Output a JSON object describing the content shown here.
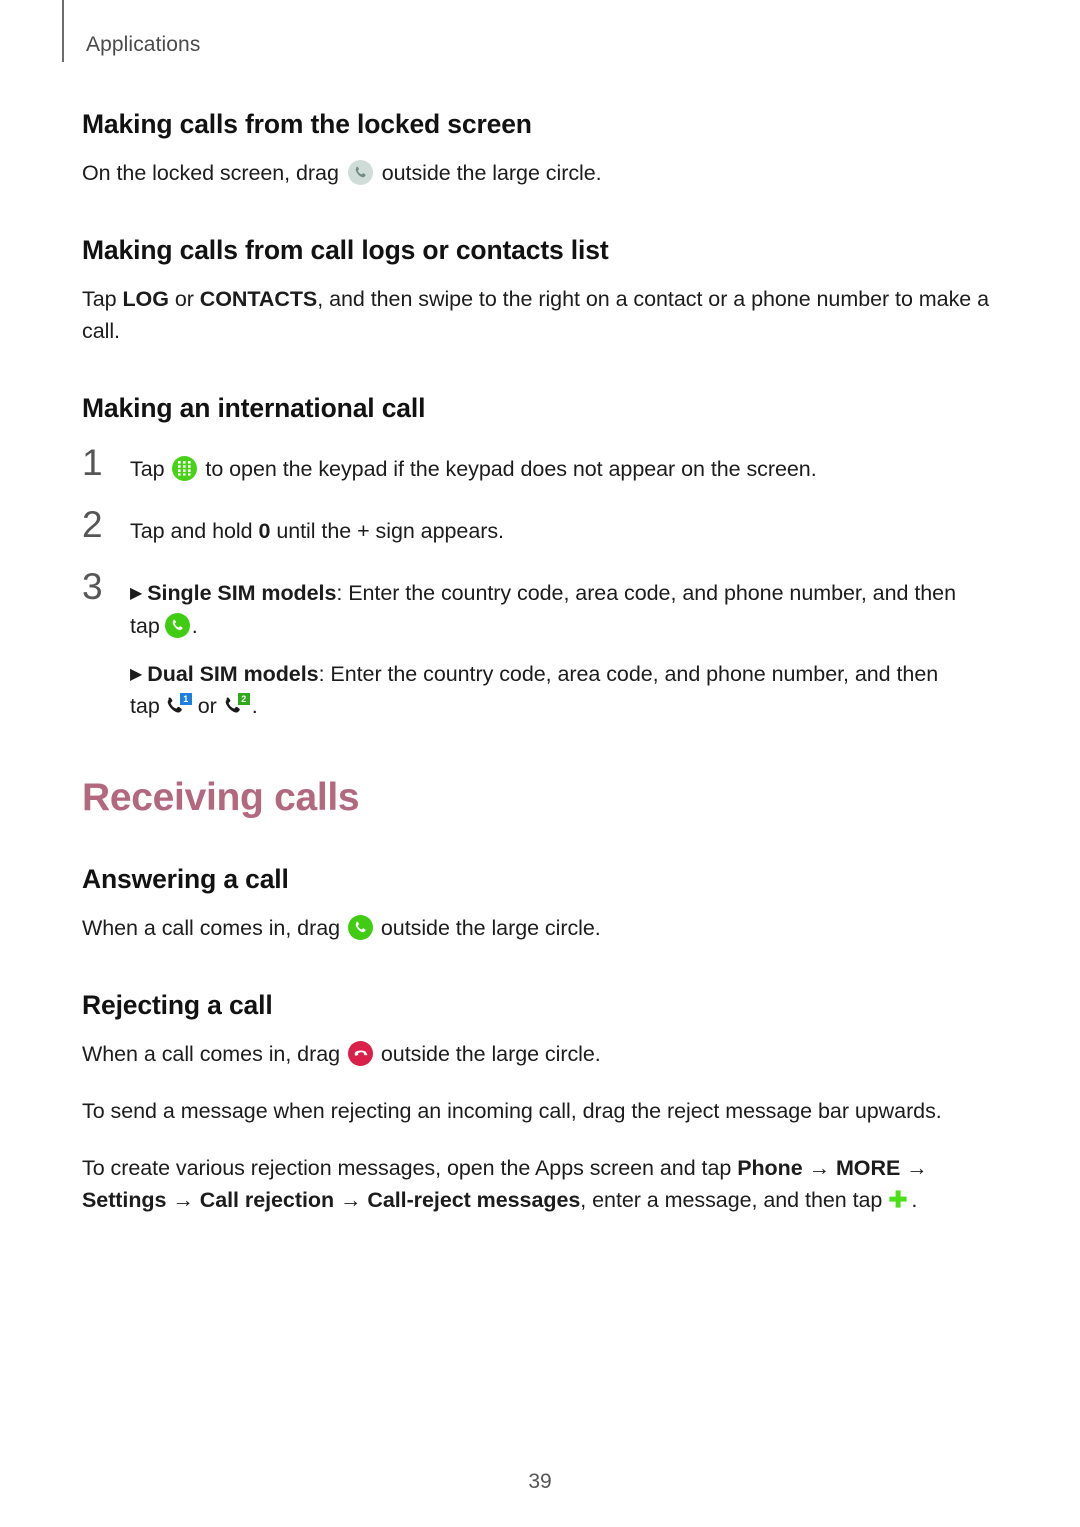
{
  "page": {
    "running_header": "Applications",
    "folio": "39"
  },
  "colors": {
    "chapter_title": "#b2687f",
    "body_text": "#1c1c1c",
    "step_number": "#565656",
    "running_header": "#4a4a4a",
    "icon_green": "#3fcc12",
    "icon_keypad_green": "#49d11a",
    "icon_reject_red": "#d8204a",
    "icon_lock_gray": "#cfdcd7",
    "sim1_blue": "#1f7fe0",
    "sim2_green": "#2faa18",
    "plus_green": "#4ce019"
  },
  "sections": {
    "locked_screen": {
      "heading": "Making calls from the locked screen",
      "body_before_icon": "On the locked screen, drag",
      "icon": "phone-handset-lockscreen-icon",
      "body_after_icon": "outside the large circle."
    },
    "call_logs": {
      "heading": "Making calls from call logs or contacts list",
      "body_part1": "Tap ",
      "bold_log": "LOG",
      "body_part2": " or ",
      "bold_contacts": "CONTACTS",
      "body_part3": ", and then swipe to the right on a contact or a phone number to make a call."
    },
    "international": {
      "heading": "Making an international call",
      "steps": [
        {
          "number": "1",
          "text_before_icon": "Tap",
          "icon": "keypad-icon",
          "text_after_icon": "to open the keypad if the keypad does not appear on the screen."
        },
        {
          "number": "2",
          "text_part1": "Tap and hold ",
          "bold": "0",
          "text_part2": " until the + sign appears."
        },
        {
          "number": "3",
          "bullets": [
            {
              "marker": "▶",
              "bold_label": "Single SIM models",
              "text": ": Enter the country code, area code, and phone number, and then tap",
              "trailing": "tap",
              "icon": "call-green-icon",
              "period": "."
            },
            {
              "marker": "▶",
              "bold_label": "Dual SIM models",
              "text": ": Enter the country code, area code, and phone number, and then tap",
              "trailing": "tap",
              "icon_1": "call-sim1-icon",
              "conjunction": "or",
              "icon_2": "call-sim2-icon",
              "period": "."
            }
          ]
        }
      ]
    },
    "receiving_calls": {
      "title": "Receiving calls",
      "answering": {
        "heading": "Answering a call",
        "body_before_icon": "When a call comes in, drag",
        "icon": "call-green-icon",
        "body_after_icon": "outside the large circle."
      },
      "rejecting": {
        "heading": "Rejecting a call",
        "body_before_icon": "When a call comes in, drag",
        "icon": "reject-call-icon",
        "body_after_icon": "outside the large circle.",
        "paragraph_2": "To send a message when rejecting an incoming call, drag the reject message bar upwards.",
        "paragraph_3": {
          "part1": "To create various rejection messages, open the Apps screen and tap ",
          "bold_phone": "Phone",
          "arrow1": " → ",
          "bold_more": "MORE",
          "arrow2": " → ",
          "bold_settings": "Settings",
          "arrow3": " → ",
          "bold_call_rejection": "Call rejection",
          "arrow4": " → ",
          "bold_call_reject_messages": "Call-reject messages",
          "part2": ", enter a message, and then tap",
          "icon": "plus-icon",
          "period": "."
        }
      }
    }
  }
}
